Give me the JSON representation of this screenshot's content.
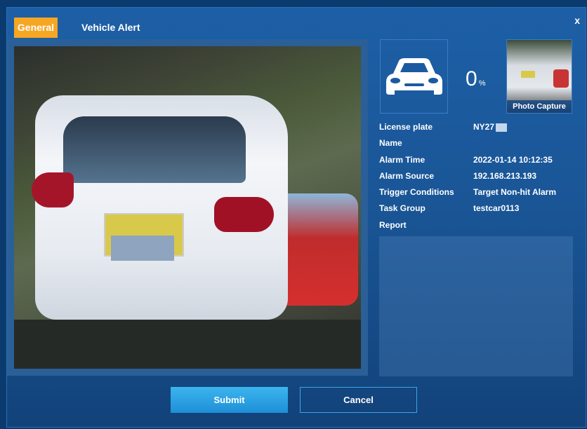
{
  "tabs": [
    {
      "label": "General"
    },
    {
      "label": "Vehicle Alert"
    }
  ],
  "close_label": "x",
  "icons": {
    "vehicle": "car-icon",
    "close": "close-icon"
  },
  "match": {
    "value": "0",
    "unit": "%"
  },
  "capture": {
    "label": "Photo Capture"
  },
  "details": {
    "license_plate": {
      "label": "License plate",
      "value": "NY27"
    },
    "name": {
      "label": "Name",
      "value": ""
    },
    "alarm_time": {
      "label": "Alarm Time",
      "value": "2022-01-14 10:12:35"
    },
    "alarm_source": {
      "label": "Alarm Source",
      "value": "192.168.213.193"
    },
    "trigger_conditions": {
      "label": "Trigger Conditions",
      "value": "Target Non-hit Alarm"
    },
    "task_group": {
      "label": "Task Group",
      "value": "testcar0113"
    },
    "report": {
      "label": "Report",
      "value": ""
    }
  },
  "buttons": {
    "submit": "Submit",
    "cancel": "Cancel"
  },
  "colors": {
    "accent": "#f5a623",
    "primary_button": "#1e8fd6"
  }
}
